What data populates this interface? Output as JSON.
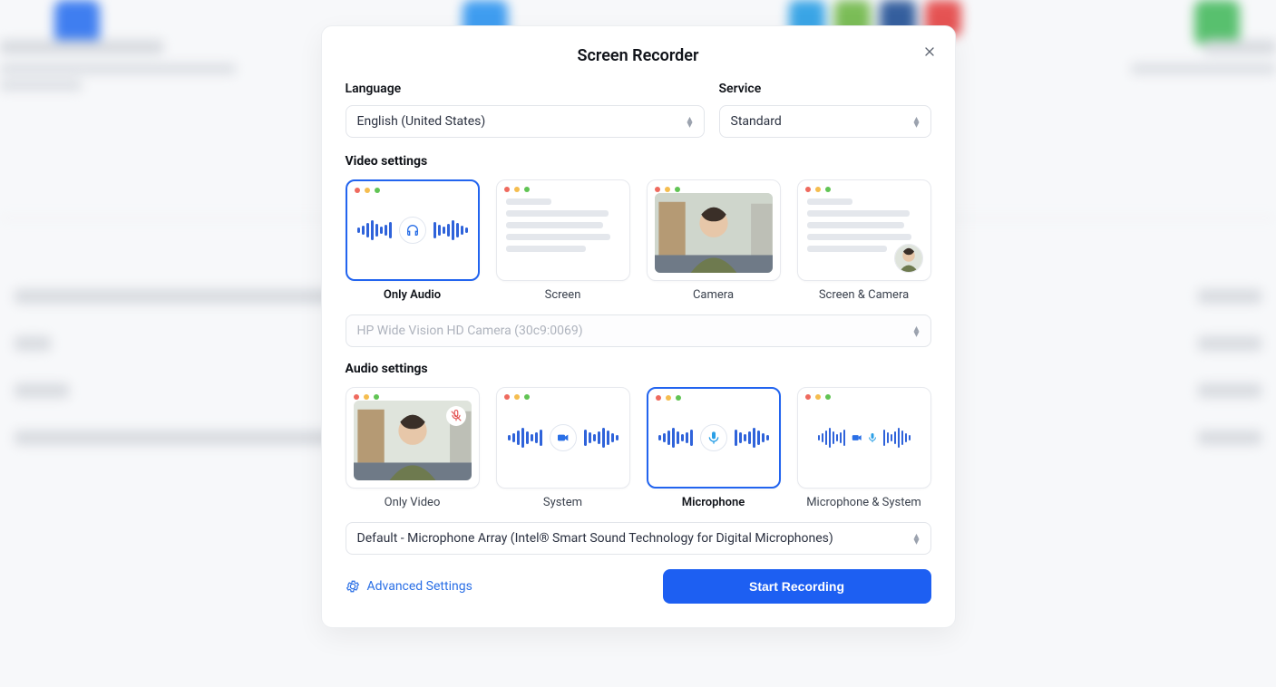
{
  "modal": {
    "title": "Screen Recorder",
    "language_label": "Language",
    "service_label": "Service",
    "language_value": "English (United States)",
    "service_value": "Standard",
    "video_settings_label": "Video settings",
    "audio_settings_label": "Audio settings",
    "camera_select": "HP Wide Vision HD Camera (30c9:0069)",
    "mic_select": "Default - Microphone Array (Intel® Smart Sound Technology for Digital Microphones)",
    "advanced": "Advanced Settings",
    "start": "Start Recording",
    "video_options": {
      "only_audio": "Only Audio",
      "screen": "Screen",
      "camera": "Camera",
      "screen_camera": "Screen & Camera"
    },
    "audio_options": {
      "only_video": "Only Video",
      "system": "System",
      "microphone": "Microphone",
      "mic_system": "Microphone & System"
    }
  },
  "colors": {
    "primary": "#1d5ff2"
  }
}
